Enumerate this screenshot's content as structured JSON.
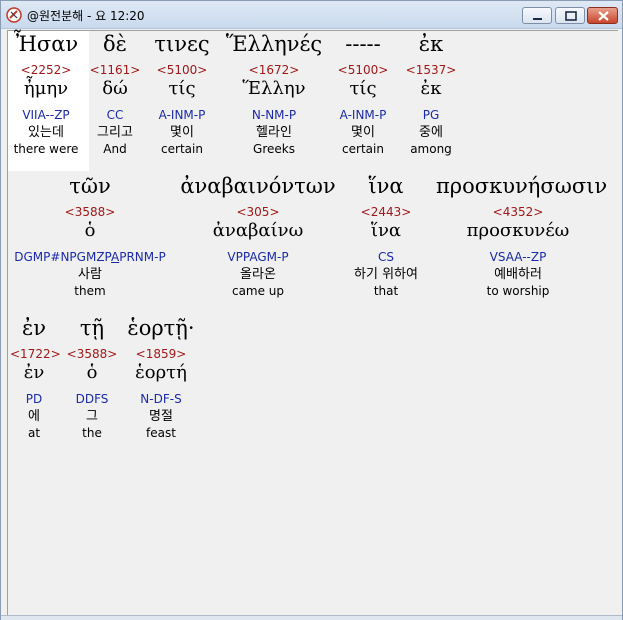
{
  "window": {
    "title": "@원전분해 - 요 12:20",
    "buttons": {
      "minimize": "minimize",
      "maximize": "maximize",
      "close": "close"
    }
  },
  "rows": [
    {
      "words": [
        {
          "greek": "Ἦσαν",
          "strongs": "<2252>",
          "lemma": "ἦμην",
          "morph": "VIIA--ZP",
          "korean": "있는데",
          "english": "there were"
        },
        {
          "greek": "δὲ",
          "strongs": "<1161>",
          "lemma": "δώ",
          "morph": "CC",
          "korean": "그리고",
          "english": "And"
        },
        {
          "greek": "τινες",
          "strongs": "<5100>",
          "lemma": "τίς",
          "morph": "A-INM-P",
          "korean": "몇이",
          "english": "certain"
        },
        {
          "greek": "Ἕλληνές",
          "strongs": "<1672>",
          "lemma": "Ἕλλην",
          "morph": "N-NM-P",
          "korean": "헬라인",
          "english": "Greeks"
        },
        {
          "greek": "-----",
          "strongs": "<5100>",
          "lemma": "τίς",
          "morph": "A-INM-P",
          "korean": "몇이",
          "english": "certain"
        },
        {
          "greek": "ἐκ",
          "strongs": "<1537>",
          "lemma": "ἐκ",
          "morph": "PG",
          "korean": "중에",
          "english": "among"
        }
      ]
    },
    {
      "words": [
        {
          "greek": "τῶν",
          "strongs": "<3588>",
          "lemma": "ὁ",
          "morph_a": "DGMP#NPGMZP",
          "morph_b": "A",
          "morph_c": "PRNM-P",
          "korean": "사람",
          "english": "them"
        },
        {
          "greek": "ἀναβαινόντων",
          "strongs": "<305>",
          "lemma": "ἀναβαίνω",
          "morph": "VPPAGM-P",
          "korean": "올라온",
          "english": "came up"
        },
        {
          "greek": "ἵνα",
          "strongs": "<2443>",
          "lemma": "ἵνα",
          "morph": "CS",
          "korean": "하기 위하여",
          "english": "that"
        },
        {
          "greek": "προσκυνήσωσιν",
          "strongs": "<4352>",
          "lemma": "προσκυνέω",
          "morph": "VSAA--ZP",
          "korean": "예배하러",
          "english": "to worship"
        }
      ]
    },
    {
      "words": [
        {
          "greek": "ἐν",
          "strongs": "<1722>",
          "lemma": "ἐν",
          "morph": "PD",
          "korean": "에",
          "english": "at"
        },
        {
          "greek": "τῇ",
          "strongs": "<3588>",
          "lemma": "ὁ",
          "morph": "DDFS",
          "korean": "그",
          "english": "the"
        },
        {
          "greek": "ἑορτῇ·",
          "strongs": "<1859>",
          "lemma": "ἑορτή",
          "morph": "N-DF-S",
          "korean": "명절",
          "english": "feast"
        }
      ]
    }
  ],
  "colors": {
    "strongs": "#a01818",
    "morph": "#1a2aa8",
    "highlight": "#ffffff",
    "background": "#f0f0f0"
  }
}
